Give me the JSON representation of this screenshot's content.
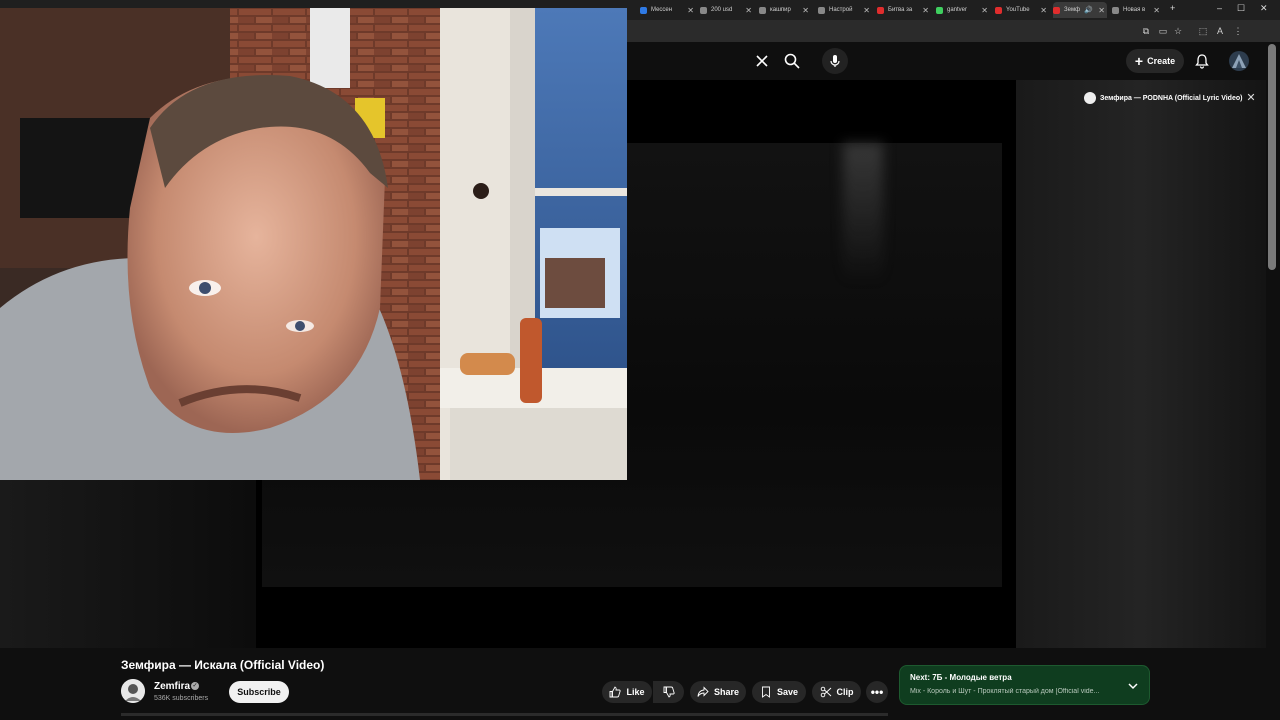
{
  "browser": {
    "tabs": [
      {
        "label": "Мессен",
        "color": "#2f7ae5"
      },
      {
        "label": "200 usd",
        "color": "#888888"
      },
      {
        "label": "кашпир",
        "color": "#888888"
      },
      {
        "label": "Настрой",
        "color": "#888888"
      },
      {
        "label": "Битва за",
        "color": "#e02d2d"
      },
      {
        "label": "gantver",
        "color": "#3fcf5f"
      },
      {
        "label": "YouTube",
        "color": "#e02d2d"
      },
      {
        "label": "Земф",
        "color": "#e02d2d"
      },
      {
        "label": "Новая в",
        "color": "#888888"
      }
    ]
  },
  "header": {
    "create_label": "Create"
  },
  "miniplayer": {
    "title": "Земфира — PODNHA (Official Lyric Video)"
  },
  "video": {
    "title": "Земфира — Искала (Official Video)",
    "channel": "Zemfira",
    "subscribers": "536K subscribers",
    "subscribe_label": "Subscribe"
  },
  "actions": {
    "like_label": "Like",
    "share_label": "Share",
    "save_label": "Save",
    "clip_label": "Clip"
  },
  "up_next": {
    "title": "Next: 7Б - Молодые ветра",
    "subtitle": "Mix - Король и Шут - Проклятый старый дом [Official vide..."
  }
}
